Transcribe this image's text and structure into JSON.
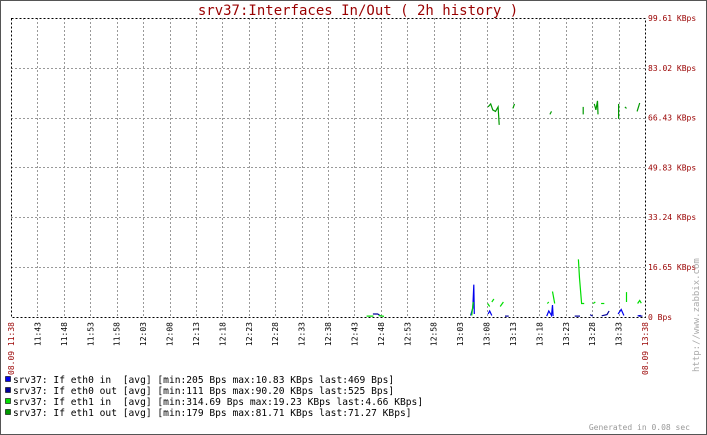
{
  "chart_data": {
    "type": "line",
    "title": "srv37:Interfaces In/Out ( 2h history )",
    "xlabel": "",
    "ylabel": "",
    "x_unit": "minutes since 08.09 11:38",
    "xlim": [
      0,
      120
    ],
    "ylim": [
      0,
      99.61
    ],
    "y_unit": "KBps",
    "grid": true,
    "y_ticks": [
      {
        "value": 0,
        "label": "0 Bps"
      },
      {
        "value": 16.65,
        "label": "16.65 KBps"
      },
      {
        "value": 33.24,
        "label": "33.24 KBps"
      },
      {
        "value": 49.83,
        "label": "49.83 KBps"
      },
      {
        "value": 66.43,
        "label": "66.43 KBps"
      },
      {
        "value": 83.02,
        "label": "83.02 KBps"
      },
      {
        "value": 99.61,
        "label": "99.61 KBps"
      }
    ],
    "x_ticks": [
      {
        "value": 5,
        "label": "11:43"
      },
      {
        "value": 10,
        "label": "11:48"
      },
      {
        "value": 15,
        "label": "11:53"
      },
      {
        "value": 20,
        "label": "11:58"
      },
      {
        "value": 25,
        "label": "12:03"
      },
      {
        "value": 30,
        "label": "12:08"
      },
      {
        "value": 35,
        "label": "12:13"
      },
      {
        "value": 40,
        "label": "12:18"
      },
      {
        "value": 45,
        "label": "12:23"
      },
      {
        "value": 50,
        "label": "12:28"
      },
      {
        "value": 55,
        "label": "12:33"
      },
      {
        "value": 60,
        "label": "12:38"
      },
      {
        "value": 65,
        "label": "12:43"
      },
      {
        "value": 70,
        "label": "12:48"
      },
      {
        "value": 75,
        "label": "12:53"
      },
      {
        "value": 80,
        "label": "12:58"
      },
      {
        "value": 85,
        "label": "13:03"
      },
      {
        "value": 90,
        "label": "13:08"
      },
      {
        "value": 95,
        "label": "13:13"
      },
      {
        "value": 100,
        "label": "13:18"
      },
      {
        "value": 105,
        "label": "13:23"
      },
      {
        "value": 110,
        "label": "13:28"
      },
      {
        "value": 115,
        "label": "13:33"
      }
    ],
    "x_start_label": "08.09 11:38",
    "x_end_label": "08.09 13:38",
    "series": [
      {
        "name": "eth0-in",
        "color": "#0000ee",
        "legend": "srv37: If eth0 in  [avg] [min:205 Bps max:10.83 KBps last:469 Bps]",
        "segments": [
          [
            [
              87.0,
              0.5
            ],
            [
              87.4,
              3
            ],
            [
              87.6,
              10.8
            ],
            [
              87.7,
              1
            ]
          ],
          [
            [
              90.3,
              1
            ],
            [
              90.6,
              2
            ],
            [
              91.0,
              0.5
            ]
          ],
          [
            [
              101.4,
              0.3
            ],
            [
              101.8,
              2
            ],
            [
              102.3,
              0.5
            ],
            [
              102.5,
              4
            ],
            [
              102.6,
              0.3
            ]
          ],
          [
            [
              114.9,
              1
            ],
            [
              115.5,
              2.5
            ],
            [
              116.0,
              0.5
            ]
          ],
          [
            [
              118.6,
              0.4
            ],
            [
              119.2,
              0.5
            ]
          ]
        ]
      },
      {
        "name": "eth0-out",
        "color": "#000099",
        "legend": "srv37: If eth0 out [avg] [min:111 Bps max:90.20 KBps last:525 Bps]",
        "segments": [
          [
            [
              68.5,
              1
            ],
            [
              69.4,
              1
            ],
            [
              70.0,
              0.3
            ]
          ],
          [
            [
              93.5,
              0.3
            ],
            [
              94.2,
              0.3
            ]
          ],
          [
            [
              106.7,
              0.3
            ],
            [
              107.7,
              0.3
            ]
          ],
          [
            [
              109.6,
              0.8
            ],
            [
              110.1,
              0.3
            ]
          ],
          [
            [
              111.8,
              0.4
            ],
            [
              112.8,
              0.8
            ],
            [
              113.2,
              2
            ]
          ],
          [
            [
              118.8,
              0.3
            ],
            [
              119.5,
              0.3
            ]
          ]
        ]
      },
      {
        "name": "eth1-in",
        "color": "#00dd00",
        "legend": "srv37: If eth1 in  [avg] [min:314.69 Bps max:19.23 KBps last:4.66 KBps]",
        "segments": [
          [
            [
              67.3,
              0.3
            ],
            [
              68.6,
              0.3
            ]
          ],
          [
            [
              69.6,
              0.5
            ],
            [
              70.6,
              0.2
            ]
          ],
          [
            [
              87.2,
              0.5
            ],
            [
              87.5,
              5
            ]
          ],
          [
            [
              90.2,
              4.5
            ],
            [
              90.6,
              3.5
            ]
          ],
          [
            [
              91.0,
              5
            ],
            [
              91.4,
              6
            ]
          ],
          [
            [
              92.6,
              3.5
            ],
            [
              93.2,
              5
            ]
          ],
          [
            [
              101.5,
              4.5
            ],
            [
              101.8,
              5
            ]
          ],
          [
            [
              102.5,
              8.5
            ],
            [
              102.9,
              4.5
            ]
          ],
          [
            [
              107.4,
              19.2
            ],
            [
              107.6,
              13
            ],
            [
              108.0,
              4.5
            ],
            [
              108.5,
              4.5
            ]
          ],
          [
            [
              110.2,
              4.5
            ],
            [
              110.6,
              5
            ]
          ],
          [
            [
              111.7,
              4.5
            ],
            [
              112.3,
              4.5
            ]
          ],
          [
            [
              116.5,
              8.3
            ],
            [
              116.5,
              5
            ]
          ],
          [
            [
              118.6,
              4.5
            ],
            [
              119.0,
              5.5
            ],
            [
              119.3,
              4.6
            ]
          ]
        ]
      },
      {
        "name": "eth1-out",
        "color": "#009900",
        "legend": "srv37: If eth1 out [avg] [min:179 Bps max:81.71 KBps last:71.27 KBps]",
        "segments": [
          [
            [
              90.3,
              70
            ],
            [
              90.8,
              71
            ],
            [
              91.2,
              69
            ],
            [
              91.7,
              68.5
            ],
            [
              92.2,
              70
            ],
            [
              92.4,
              64
            ]
          ],
          [
            [
              95.0,
              69.5
            ],
            [
              95.3,
              71
            ]
          ],
          [
            [
              102.0,
              67.5
            ],
            [
              102.3,
              68.5
            ]
          ],
          [
            [
              108.3,
              67.5
            ],
            [
              108.3,
              70
            ]
          ],
          [
            [
              110.4,
              71
            ],
            [
              110.7,
              69
            ],
            [
              111.0,
              72
            ],
            [
              111.1,
              67.5
            ]
          ],
          [
            [
              115.0,
              66
            ],
            [
              115.0,
              71
            ]
          ],
          [
            [
              116.2,
              70
            ],
            [
              116.5,
              69.5
            ]
          ],
          [
            [
              118.5,
              68.5
            ],
            [
              119.0,
              71.3
            ]
          ]
        ]
      }
    ]
  },
  "watermark": "http://www.zabbix.com",
  "generated": "Generated in 0.08 sec",
  "colors": {
    "title": "#990000",
    "axis_label": "#990000",
    "grid": "#999999"
  }
}
